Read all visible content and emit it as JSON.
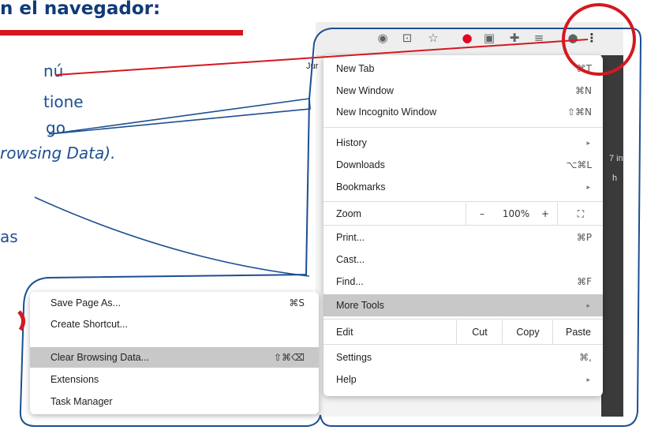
{
  "instructions": {
    "heading": "n el navegador:",
    "line1": "nú",
    "line2": "tione",
    "line3": "go",
    "line4": "rowsing Data).",
    "line5": "as"
  },
  "browser": {
    "page_fragment": "Jur",
    "dark_fragments": [
      "7 in",
      "h"
    ],
    "toolbar_icons": [
      "extension-icon",
      "translate-icon",
      "bookmark-star-icon",
      "pinterest-icon",
      "cast-icon",
      "puzzle-icon",
      "reading-list-icon",
      "profile-icon",
      "kebab-menu-icon"
    ]
  },
  "menu": {
    "new_tab": "New Tab",
    "new_tab_sc": "⌘T",
    "new_window": "New Window",
    "new_window_sc": "⌘N",
    "incognito": "New Incognito Window",
    "incognito_sc": "⇧⌘N",
    "history": "History",
    "downloads": "Downloads",
    "downloads_sc": "⌥⌘L",
    "bookmarks": "Bookmarks",
    "zoom": "Zoom",
    "zoom_minus": "–",
    "zoom_value": "100%",
    "zoom_plus": "+",
    "print": "Print...",
    "print_sc": "⌘P",
    "cast": "Cast...",
    "find": "Find...",
    "find_sc": "⌘F",
    "more_tools": "More Tools",
    "edit": "Edit",
    "cut": "Cut",
    "copy": "Copy",
    "paste": "Paste",
    "settings": "Settings",
    "settings_sc": "⌘,",
    "help": "Help",
    "arrow": "▸"
  },
  "submenu": {
    "save_page": "Save Page As...",
    "save_page_sc": "⌘S",
    "create_shortcut": "Create Shortcut...",
    "clear_data": "Clear Browsing Data...",
    "clear_data_sc": "⇧⌘⌫",
    "extensions": "Extensions",
    "task_manager": "Task Manager"
  },
  "colors": {
    "accent_red": "#d4181f",
    "callout_outline": "#1d4f91",
    "heading_blue": "#0f3b78",
    "highlight_gray": "#c8c8c8"
  }
}
